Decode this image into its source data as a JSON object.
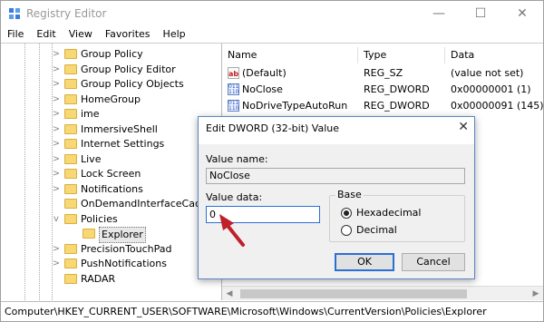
{
  "window": {
    "title": "Registry Editor",
    "controls": {
      "minimize": "—",
      "maximize": "☐",
      "close": "✕"
    }
  },
  "menu": [
    "File",
    "Edit",
    "View",
    "Favorites",
    "Help"
  ],
  "tree": {
    "items": [
      {
        "label": "Group Policy",
        "expander": ">"
      },
      {
        "label": "Group Policy Editor",
        "expander": ">"
      },
      {
        "label": "Group Policy Objects",
        "expander": ">"
      },
      {
        "label": "HomeGroup",
        "expander": ">"
      },
      {
        "label": "ime",
        "expander": ">"
      },
      {
        "label": "ImmersiveShell",
        "expander": ">"
      },
      {
        "label": "Internet Settings",
        "expander": ">"
      },
      {
        "label": "Live",
        "expander": ">"
      },
      {
        "label": "Lock Screen",
        "expander": ">"
      },
      {
        "label": "Notifications",
        "expander": ">"
      },
      {
        "label": "OnDemandInterfaceCache",
        "expander": ""
      },
      {
        "label": "Policies",
        "expander": "v"
      },
      {
        "label": "Explorer",
        "expander": "",
        "selected": true
      },
      {
        "label": "PrecisionTouchPad",
        "expander": ">"
      },
      {
        "label": "PushNotifications",
        "expander": ">"
      },
      {
        "label": "RADAR",
        "expander": ""
      }
    ]
  },
  "list": {
    "headers": {
      "name": "Name",
      "type": "Type",
      "data": "Data"
    },
    "rows": [
      {
        "icon": "ab",
        "name": "(Default)",
        "type": "REG_SZ",
        "data": "(value not set)"
      },
      {
        "icon": "bin",
        "name": "NoClose",
        "type": "REG_DWORD",
        "data": "0x00000001 (1)"
      },
      {
        "icon": "bin",
        "name": "NoDriveTypeAutoRun",
        "type": "REG_DWORD",
        "data": "0x00000091 (145)"
      }
    ]
  },
  "status": {
    "path": "Computer\\HKEY_CURRENT_USER\\SOFTWARE\\Microsoft\\Windows\\CurrentVersion\\Policies\\Explorer"
  },
  "dialog": {
    "title": "Edit DWORD (32-bit) Value",
    "close": "✕",
    "value_name_label": "Value name:",
    "value_name": "NoClose",
    "value_data_label": "Value data:",
    "value_data": "0",
    "base_label": "Base",
    "radio_hex": "Hexadecimal",
    "radio_dec": "Decimal",
    "base_selected": "Hexadecimal",
    "ok": "OK",
    "cancel": "Cancel"
  },
  "colors": {
    "annotation_arrow": "#c0202a",
    "folder": "#f8d775",
    "focus": "#2a6fd6"
  }
}
